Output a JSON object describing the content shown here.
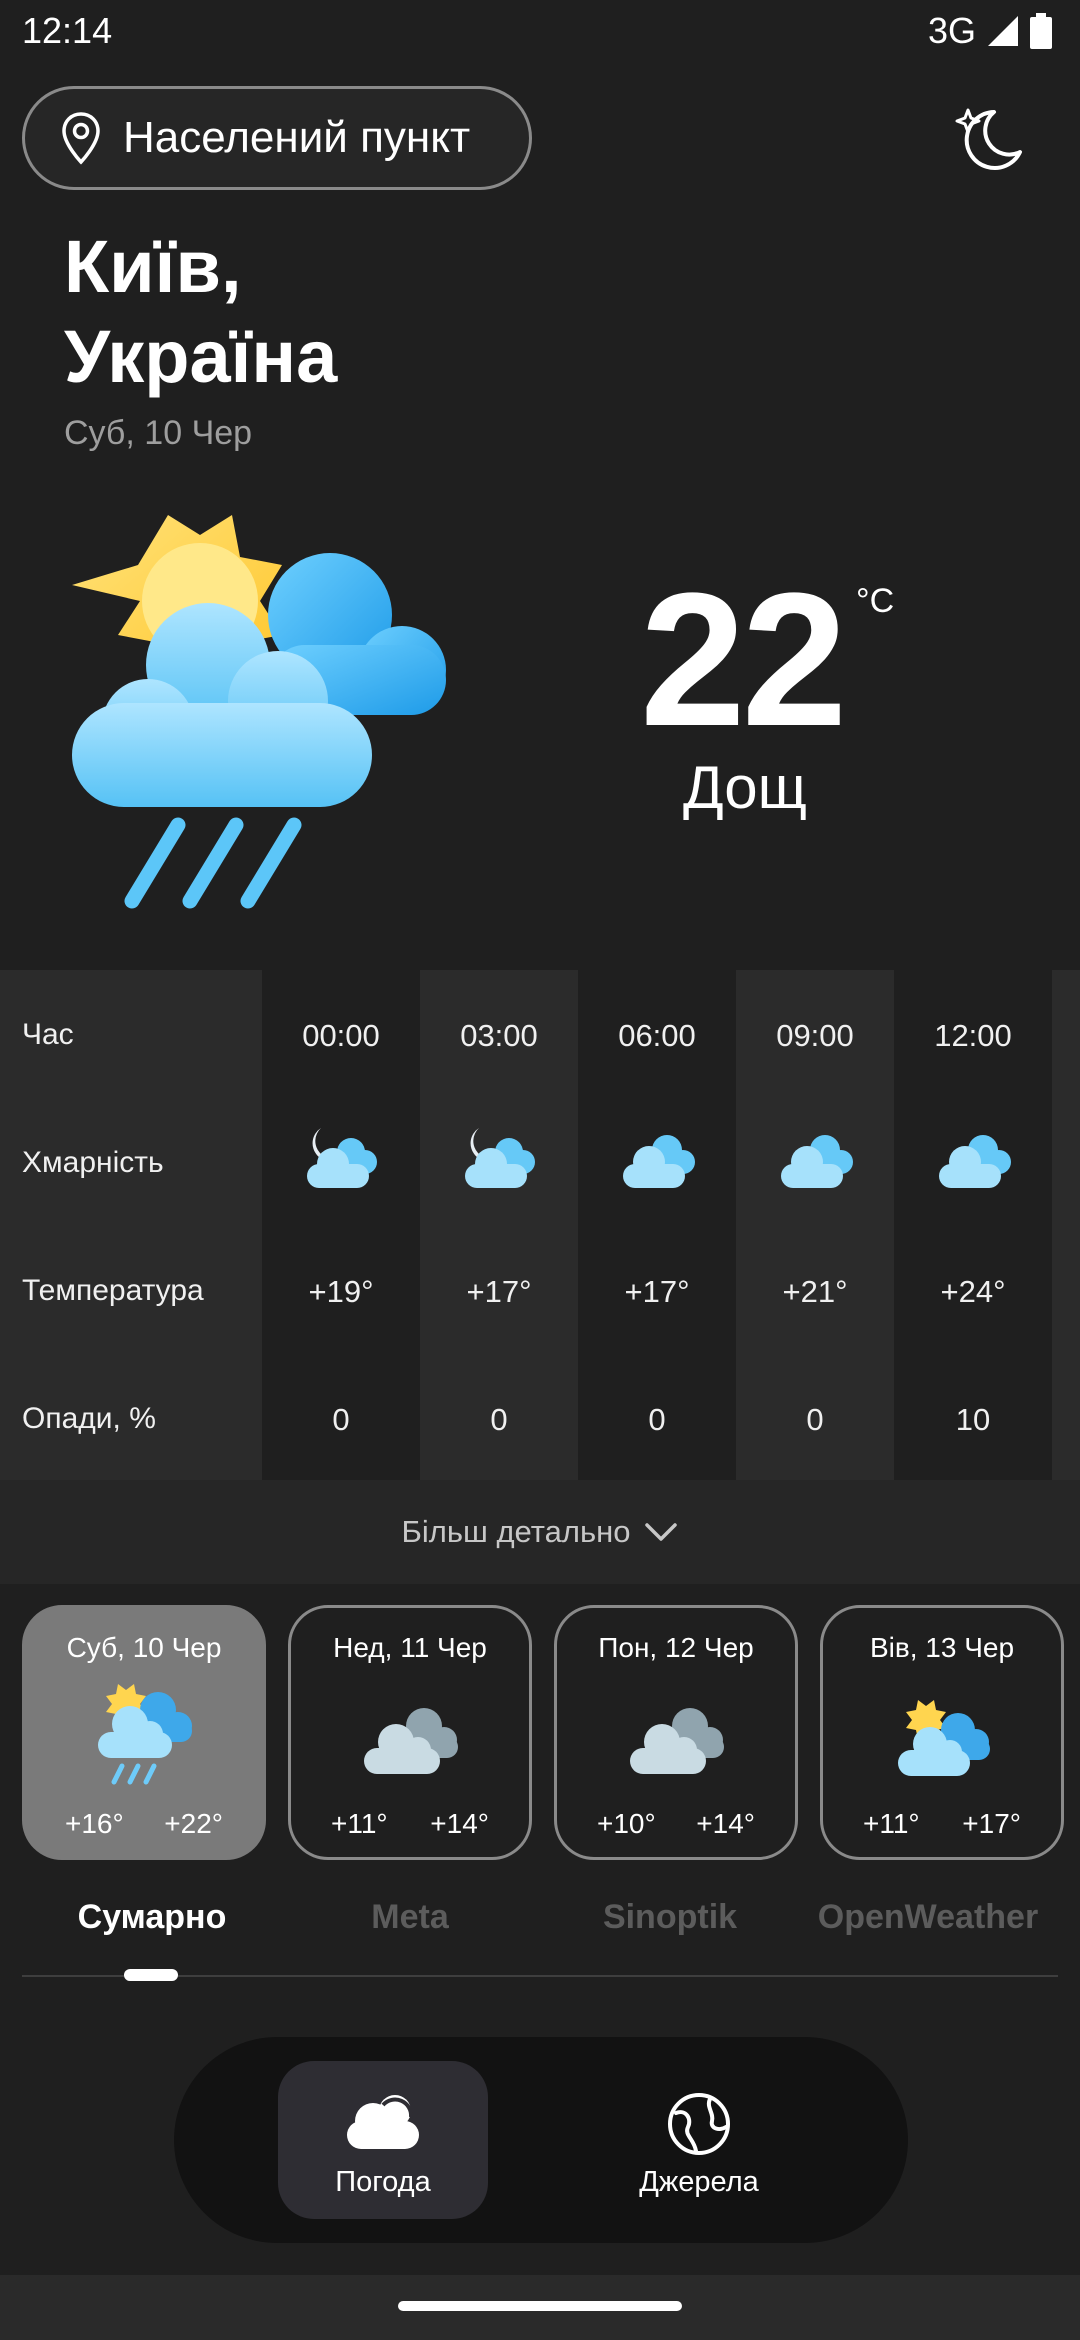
{
  "status": {
    "time": "12:14",
    "network": "3G"
  },
  "search": {
    "label": "Населений пункт"
  },
  "location": {
    "city": "Київ,",
    "country": "Україна",
    "date": "Суб, 10 Чер"
  },
  "current": {
    "temp": "22",
    "unit": "°C",
    "condition": "Дощ"
  },
  "hourly": {
    "row_labels": [
      "Час",
      "Хмарність",
      "Температура",
      "Опади, %"
    ],
    "columns": [
      {
        "time": "00:00",
        "icon": "moon-cloud-icon",
        "temp": "+19°",
        "precip": "0"
      },
      {
        "time": "03:00",
        "icon": "moon-cloud-icon",
        "temp": "+17°",
        "precip": "0"
      },
      {
        "time": "06:00",
        "icon": "cloud-icon",
        "temp": "+17°",
        "precip": "0"
      },
      {
        "time": "09:00",
        "icon": "cloud-icon",
        "temp": "+21°",
        "precip": "0"
      },
      {
        "time": "12:00",
        "icon": "cloud-icon",
        "temp": "+24°",
        "precip": "10"
      }
    ]
  },
  "more_details": "Більш детально",
  "days": [
    {
      "date": "Суб, 10 Чер",
      "low": "+16°",
      "high": "+22°",
      "icon": "sun-cloud-rain-icon",
      "selected": true
    },
    {
      "date": "Нед, 11 Чер",
      "low": "+11°",
      "high": "+14°",
      "icon": "overcast-icon",
      "selected": false
    },
    {
      "date": "Пон, 12 Чер",
      "low": "+10°",
      "high": "+14°",
      "icon": "overcast-icon",
      "selected": false
    },
    {
      "date": "Вів, 13 Чер",
      "low": "+11°",
      "high": "+17°",
      "icon": "sun-cloud-icon",
      "selected": false
    }
  ],
  "source_tabs": [
    "Сумарно",
    "Meta",
    "Sinoptik",
    "OpenWeather"
  ],
  "nav": {
    "weather": "Погода",
    "sources": "Джерела"
  },
  "colors": {
    "background": "#1f1f1f",
    "table_alt": "#2b2b2b",
    "selected_card": "#7a7a7a",
    "sky_blue": "#4fc3f7",
    "sun": "#ffd54f"
  }
}
